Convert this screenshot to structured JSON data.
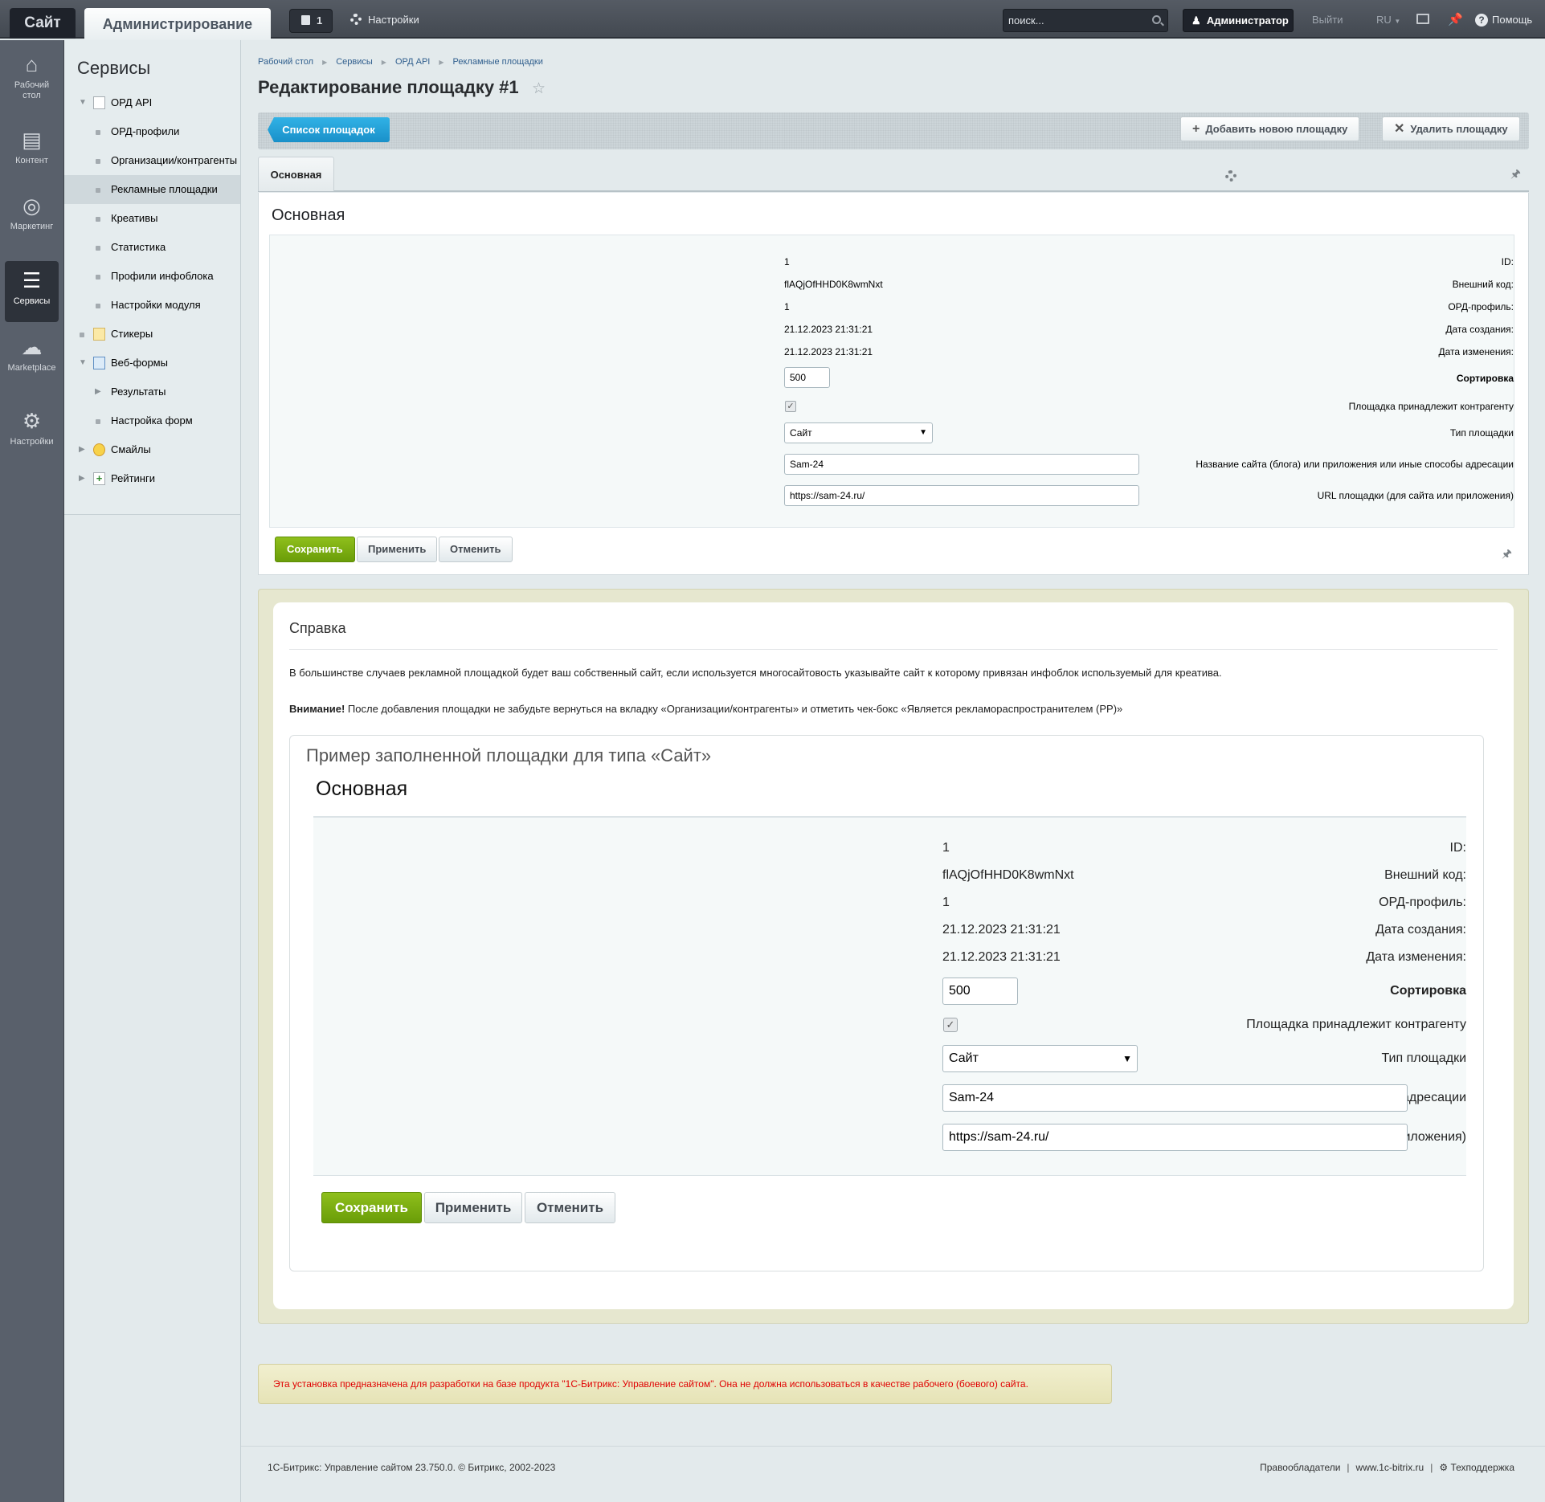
{
  "topbar": {
    "site_tab": "Сайт",
    "admin_tab": "Администрирование",
    "notifications_count": "1",
    "settings_label": "Настройки",
    "search_placeholder": "поиск...",
    "user_label": "Администратор",
    "logout_label": "Выйти",
    "language": "RU",
    "help_label": "Помощь"
  },
  "rail": {
    "items": [
      {
        "label": "Рабочий стол",
        "icon": "home-icon"
      },
      {
        "label": "Контент",
        "icon": "document-icon"
      },
      {
        "label": "Маркетинг",
        "icon": "target-icon"
      },
      {
        "label": "Сервисы",
        "icon": "layers-icon",
        "active": true
      },
      {
        "label": "Marketplace",
        "icon": "cloud-download-icon"
      },
      {
        "label": "Настройки",
        "icon": "gear-icon"
      }
    ]
  },
  "sidebar": {
    "title": "Сервисы",
    "items": [
      {
        "label": "ОРД API",
        "level": 0,
        "expanded": true
      },
      {
        "label": "ОРД-профили",
        "level": 1
      },
      {
        "label": "Организации/контрагенты",
        "level": 1
      },
      {
        "label": "Рекламные площадки",
        "level": 1,
        "selected": true
      },
      {
        "label": "Креативы",
        "level": 1
      },
      {
        "label": "Статистика",
        "level": 1
      },
      {
        "label": "Профили инфоблока",
        "level": 1
      },
      {
        "label": "Настройки модуля",
        "level": 1
      },
      {
        "label": "Стикеры",
        "level": 0
      },
      {
        "label": "Веб-формы",
        "level": 0,
        "expanded": true
      },
      {
        "label": "Результаты",
        "level": 1,
        "collapsed": true
      },
      {
        "label": "Настройка форм",
        "level": 1
      },
      {
        "label": "Смайлы",
        "level": 0,
        "collapsed": true
      },
      {
        "label": "Рейтинги",
        "level": 0,
        "collapsed": true
      }
    ]
  },
  "breadcrumbs": [
    "Рабочий стол",
    "Сервисы",
    "ОРД API",
    "Рекламные площадки"
  ],
  "page_title": "Редактирование площадку #1",
  "toolbar": {
    "list_button": "Список площадок",
    "add_button": "Добавить новою площадку",
    "delete_button": "Удалить площадку"
  },
  "tabs": [
    "Основная"
  ],
  "form": {
    "section_title": "Основная",
    "fields": {
      "id": {
        "label": "ID:",
        "value": "1"
      },
      "external_code": {
        "label": "Внешний код:",
        "value": "flAQjOfHHD0K8wmNxt"
      },
      "ord_profile": {
        "label": "ОРД-профиль:",
        "value": "1"
      },
      "created": {
        "label": "Дата создания:",
        "value": "21.12.2023 21:31:21"
      },
      "modified": {
        "label": "Дата изменения:",
        "value": "21.12.2023 21:31:21"
      },
      "sort": {
        "label": "Сортировка",
        "value": "500"
      },
      "belongs": {
        "label": "Площадка принадлежит контрагенту",
        "checked": true
      },
      "type": {
        "label": "Тип площадки",
        "value": "Сайт"
      },
      "site_name": {
        "label": "Название сайта (блога) или приложения или иные способы адресации",
        "value": "Sam-24"
      },
      "url": {
        "label": "URL площадки (для сайта или приложения)",
        "value": "https://sam-24.ru/"
      }
    },
    "save": "Сохранить",
    "apply": "Применить",
    "cancel": "Отменить"
  },
  "help": {
    "title": "Справка",
    "paragraph1": "В большинстве случаев рекламной площадкой будет ваш собственный сайт, если используется многосайтовость указывайте сайт к которому привязан инфоблок используемый для креатива.",
    "warning_bold": "Внимание!",
    "paragraph2": " После добавления площадки не забудьте вернуться на вкладку «Организации/контрагенты» и отметить чек-бокс «Является рекламораспространителем (РР)»",
    "example_title": "Пример заполненной площадки для типа «Сайт»"
  },
  "notice": "Эта установка предназначена для разработки на базе продукта \"1С-Битрикс: Управление сайтом\". Она не должна использоваться в качестве рабочего (боевого) сайта.",
  "footer": {
    "copyright": "1С-Битрикс: Управление сайтом 23.750.0. © Битрикс, 2002-2023",
    "links": [
      "Правообладатели",
      "www.1c-bitrix.ru",
      "Техподдержка"
    ]
  }
}
